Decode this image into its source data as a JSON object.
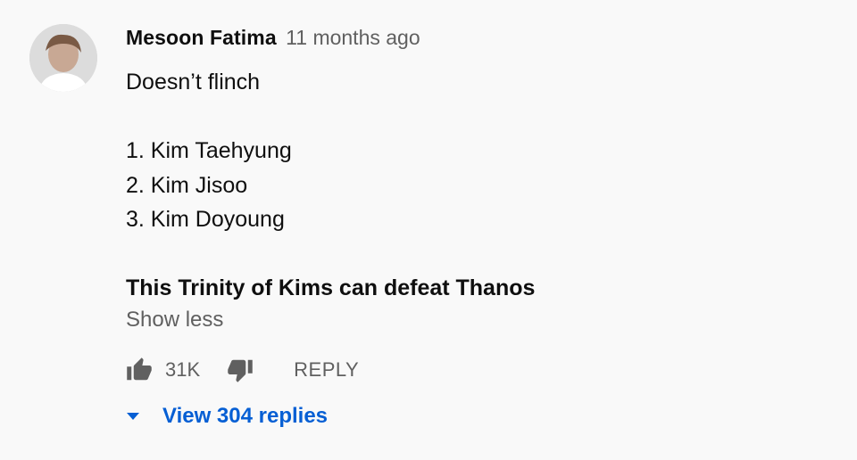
{
  "comment": {
    "author": "Mesoon Fatima",
    "time": "11 months ago",
    "lines": [
      "Doesn’t flinch",
      "1. Kim Taehyung",
      "2. Kim Jisoo",
      "3. Kim Doyoung"
    ],
    "bold_line": "This Trinity of Kims can defeat Thanos",
    "show_less": "Show less",
    "likes": "31K",
    "reply_label": "REPLY",
    "view_replies": "View 304 replies"
  },
  "icons": {
    "like": "thumb-up-icon",
    "dislike": "thumb-down-icon",
    "expand": "caret-down-icon"
  },
  "colors": {
    "background": "#f9f9f9",
    "text": "#0f0f0f",
    "secondary": "#606060",
    "link": "#065fd4"
  }
}
